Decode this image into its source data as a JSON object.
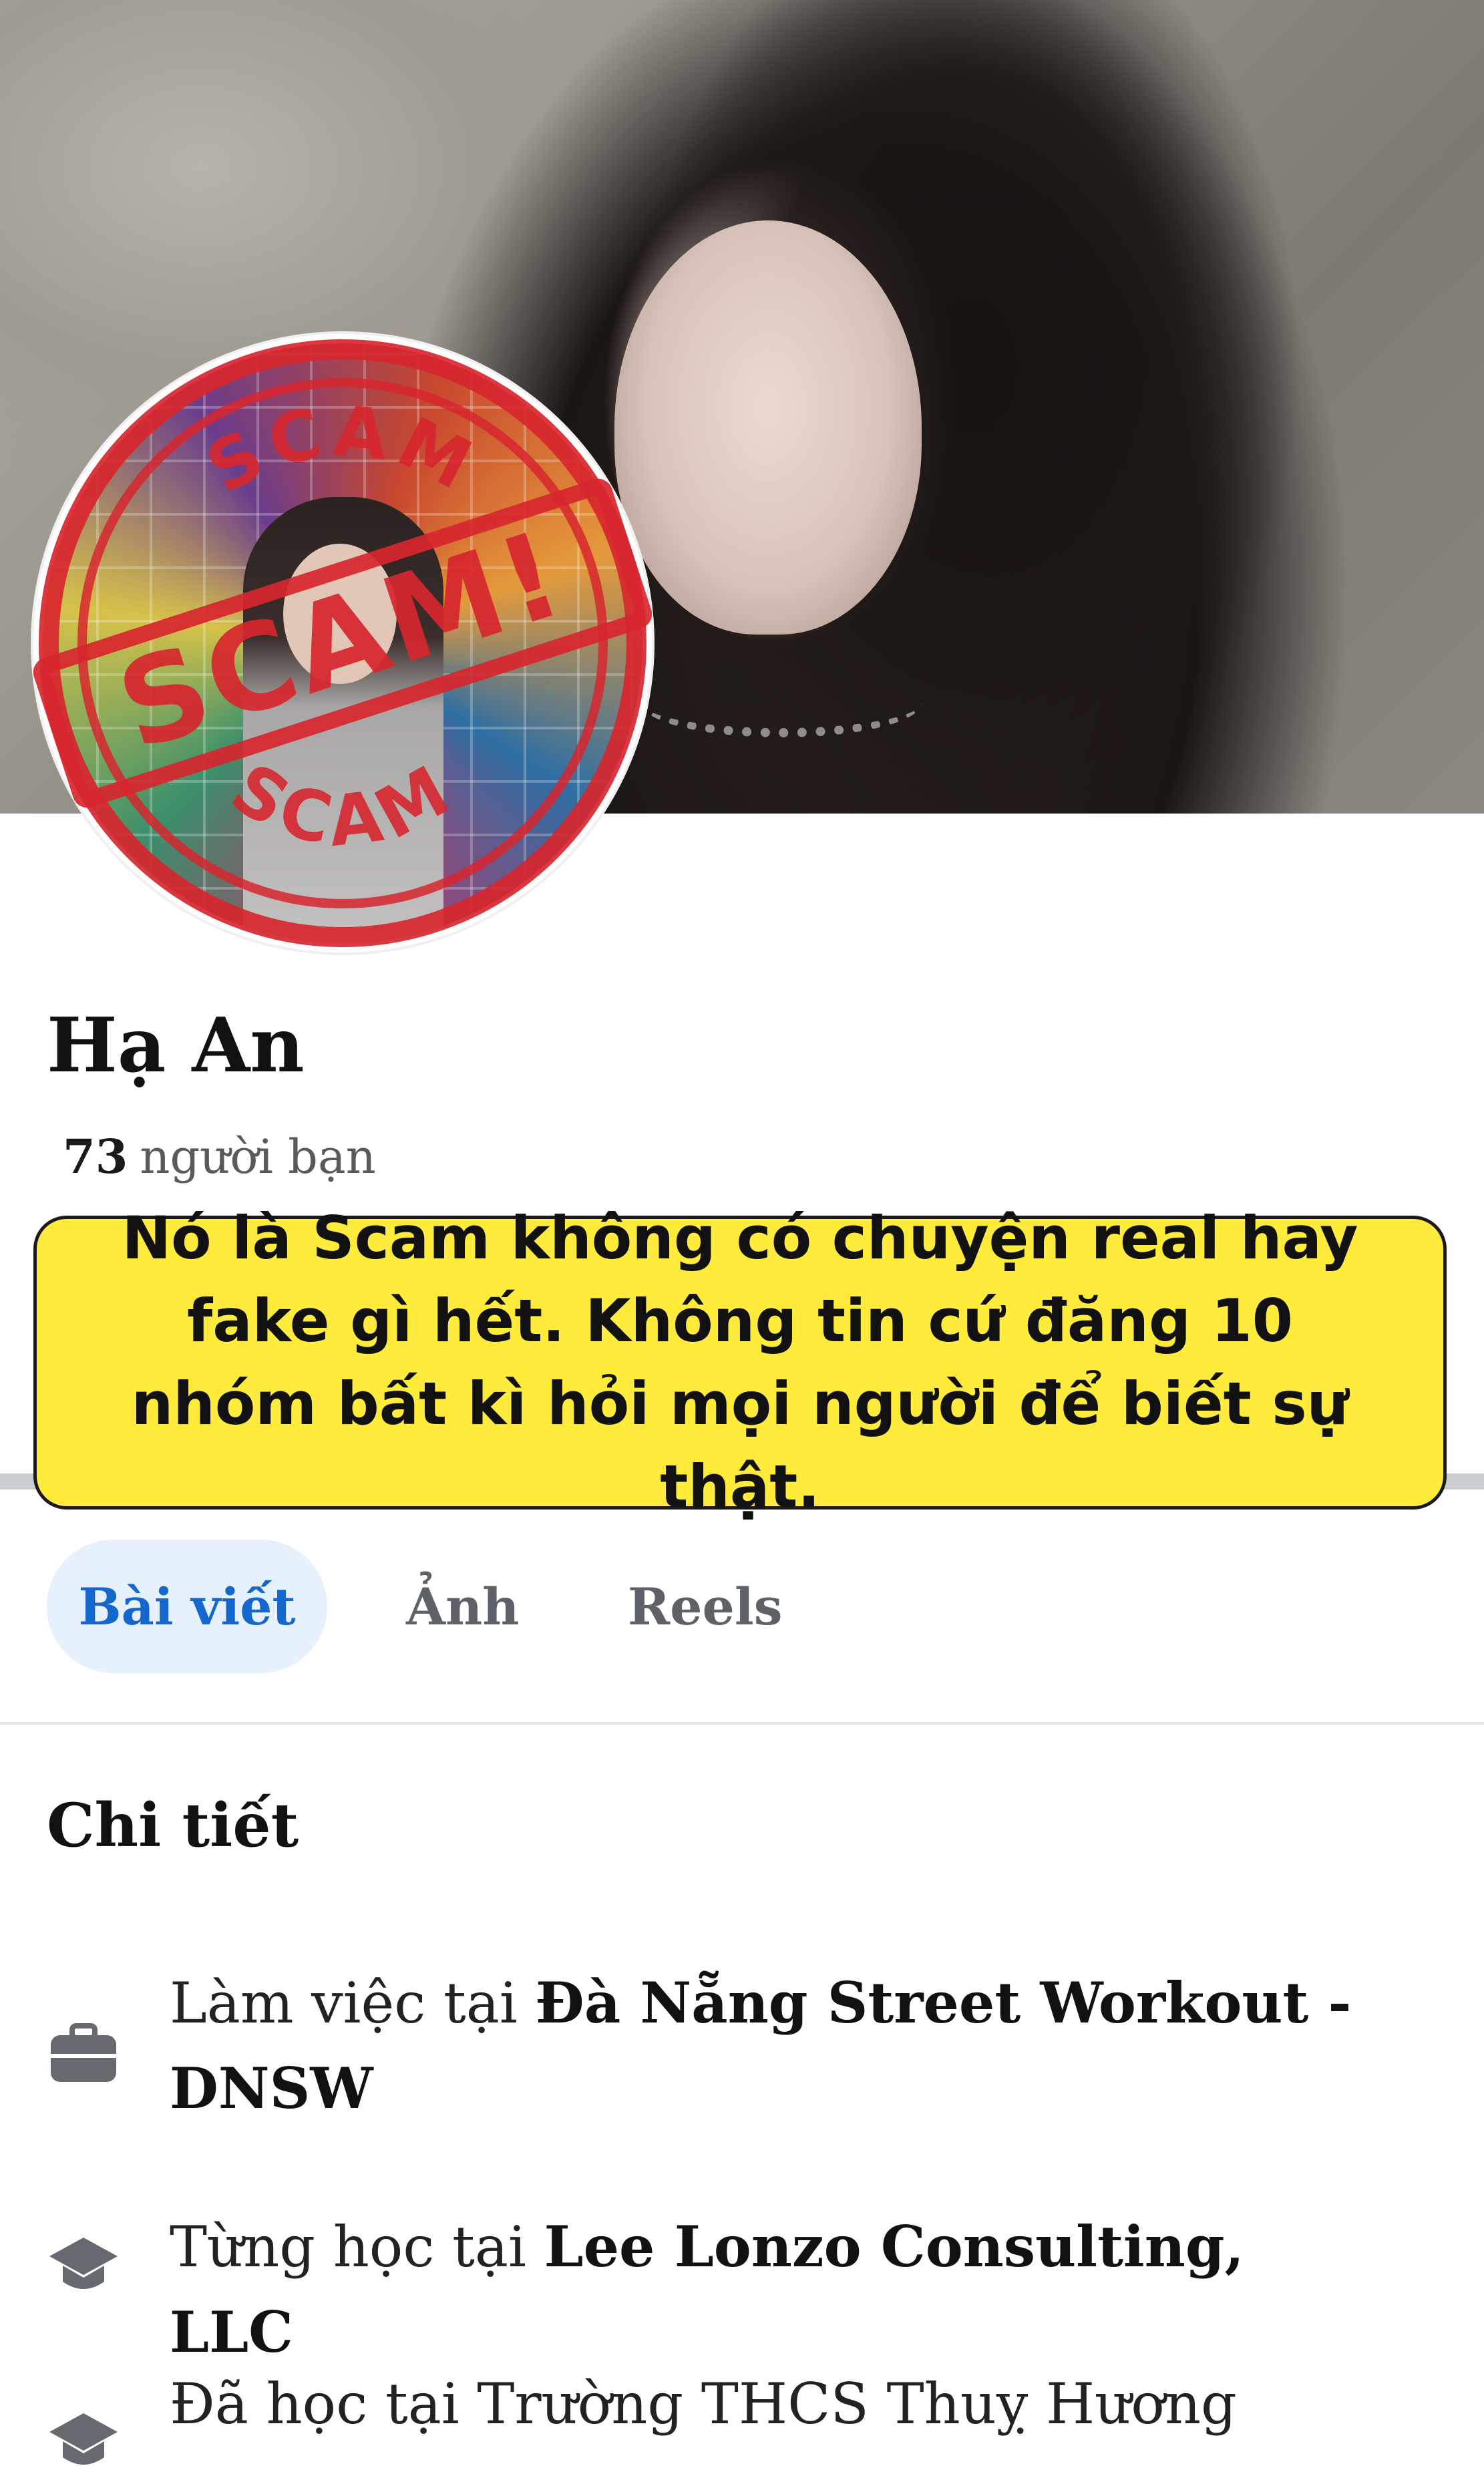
{
  "profile": {
    "name": "Hạ An",
    "friends_count": "73",
    "friends_label": "người bạn"
  },
  "stamp": {
    "main_text": "SCAM!",
    "ring_text": "SCAM",
    "color": "#d7262e"
  },
  "note": {
    "text": "Nó là Scam không có chuyện real hay fake gì hết. Không tin cứ đăng 10 nhóm bất kì hỏi mọi người để biết sự thật.",
    "background": "#ffeb3b"
  },
  "tabs": [
    {
      "label": "Bài viết",
      "active": true
    },
    {
      "label": "Ảnh",
      "active": false
    },
    {
      "label": "Reels",
      "active": false
    }
  ],
  "details": {
    "title": "Chi tiết",
    "items": [
      {
        "icon": "briefcase-icon",
        "prefix": "Làm việc tại ",
        "value": "Đà Nẵng Street Workout - DNSW"
      },
      {
        "icon": "graduation-cap-icon",
        "prefix": "Từng học tại ",
        "value": "Lee Lonzo Consulting, LLC"
      },
      {
        "icon": "graduation-cap-icon",
        "prefix": "Đã học tại ",
        "value": "Trường THCS Thuỵ Hương"
      }
    ]
  },
  "colors": {
    "accent": "#1467cc",
    "tab_active_bg": "#e7f0fd",
    "divider": "#c9ccd1"
  }
}
